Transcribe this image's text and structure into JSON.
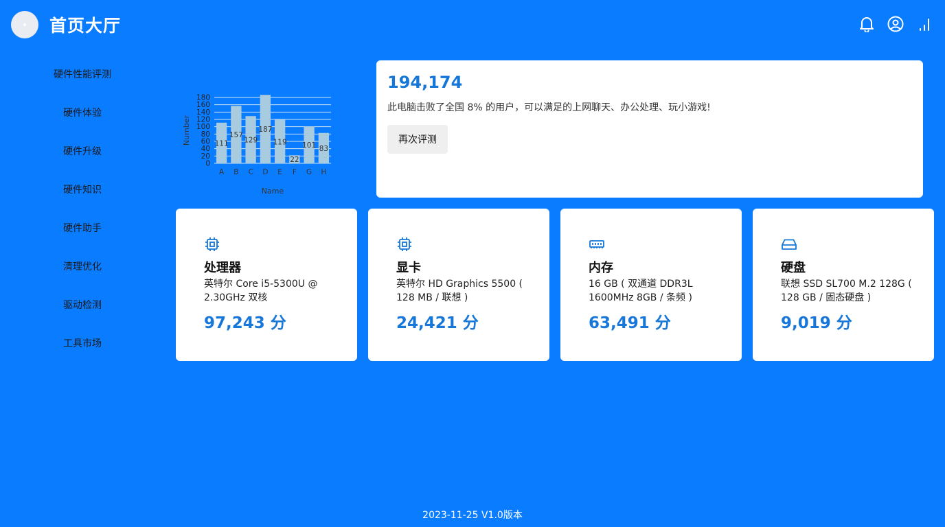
{
  "header": {
    "title": "首页大厅",
    "icons": [
      "bell-icon",
      "user-circle-icon",
      "signal-icon"
    ]
  },
  "sidebar": {
    "items": [
      {
        "label": "硬件性能评测"
      },
      {
        "label": "硬件体验"
      },
      {
        "label": "硬件升级"
      },
      {
        "label": "硬件知识"
      },
      {
        "label": "硬件助手"
      },
      {
        "label": "清理优化"
      },
      {
        "label": "驱动检测"
      },
      {
        "label": "工具市场"
      }
    ]
  },
  "chart_data": {
    "type": "bar",
    "title": "",
    "xlabel": "Name",
    "ylabel": "Number",
    "categories": [
      "A",
      "B",
      "C",
      "D",
      "E",
      "F",
      "G",
      "H"
    ],
    "values": [
      111,
      157,
      129,
      187,
      119,
      22,
      101,
      83
    ],
    "ylim": [
      0,
      180
    ],
    "yticks": [
      0,
      20,
      40,
      60,
      80,
      100,
      120,
      140,
      160,
      180
    ],
    "grid": true,
    "bar_color": "#a8cbe0"
  },
  "score_card": {
    "total": "194,174",
    "description": "此电脑击败了全国 8% 的用户，可以满足的上网聊天、办公处理、玩小游戏!",
    "retest_label": "再次评测"
  },
  "hardware": [
    {
      "icon": "cpu-icon",
      "name": "处理器",
      "detail": "英特尔 Core i5-5300U @ 2.30GHz 双核",
      "score": "97,243 分"
    },
    {
      "icon": "gpu-chip-icon",
      "name": "显卡",
      "detail": "英特尔 HD Graphics 5500 ( 128 MB / 联想 )",
      "score": "24,421 分"
    },
    {
      "icon": "memory-icon",
      "name": "内存",
      "detail": "16 GB ( 双通道 DDR3L 1600MHz 8GB / 条频 )",
      "score": "63,491 分"
    },
    {
      "icon": "hard-drive-icon",
      "name": "硬盘",
      "detail": "联想 SSD SL700 M.2 128G ( 128 GB / 固态硬盘 )",
      "score": "9,019 分"
    }
  ],
  "footer": {
    "text": "2023-11-25 V1.0版本"
  },
  "colors": {
    "background": "#0a7cff",
    "accent": "#1677d8",
    "card": "#ffffff"
  }
}
